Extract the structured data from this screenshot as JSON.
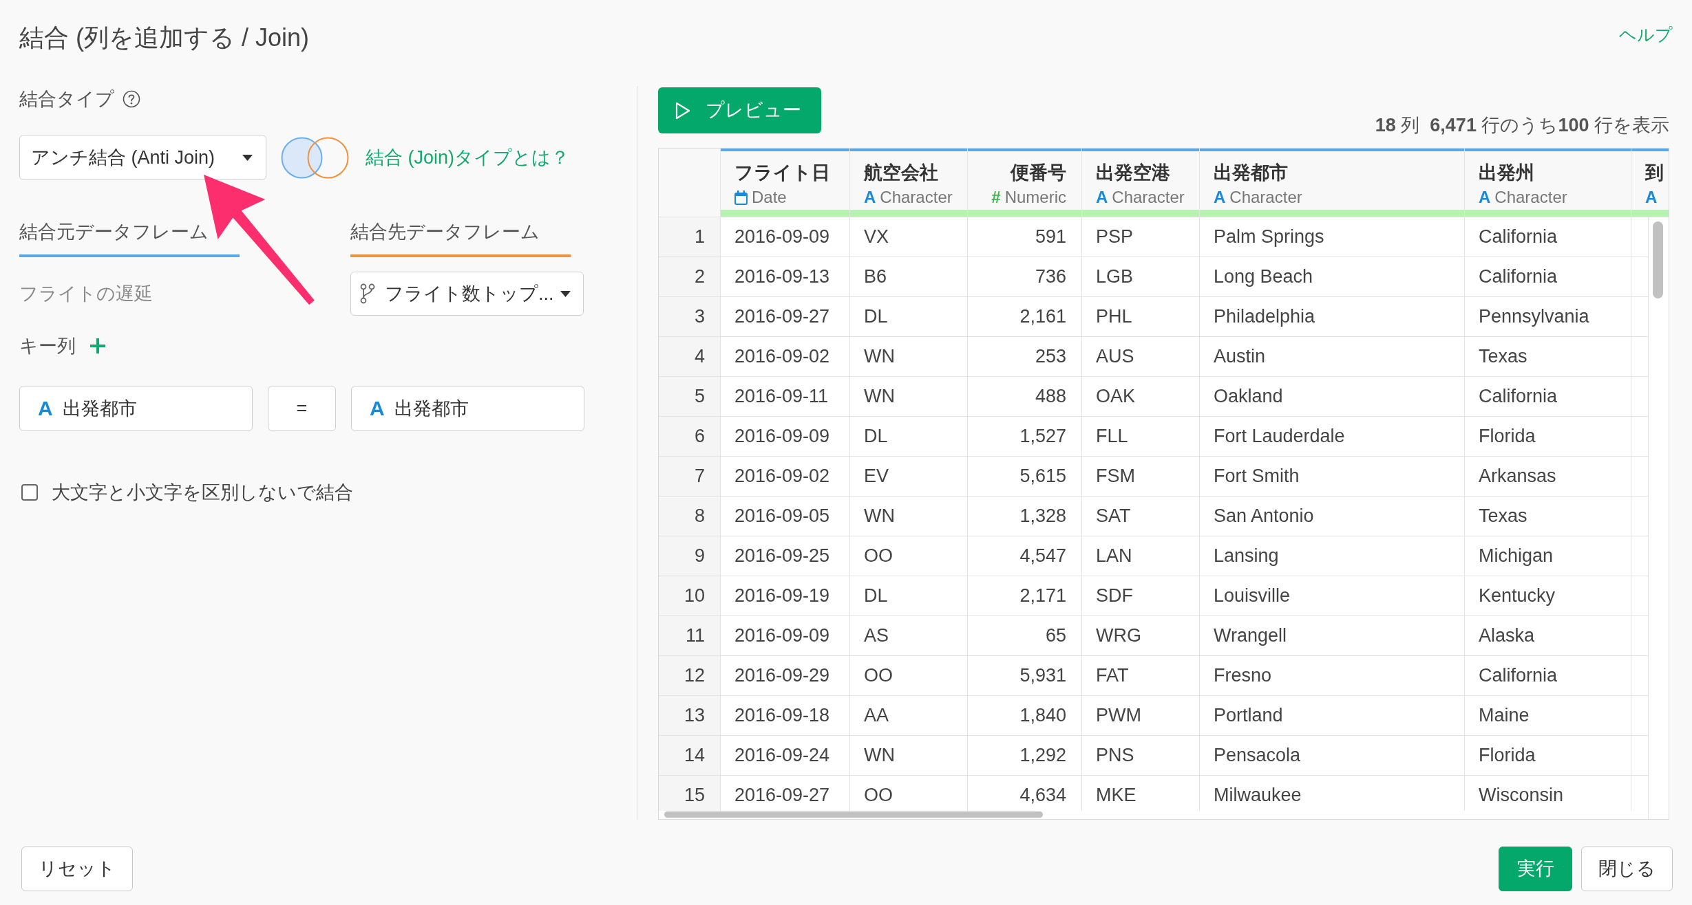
{
  "dialog": {
    "title": "結合 (列を追加する / Join)",
    "help_link": "ヘルプ"
  },
  "join_type": {
    "label": "結合タイプ",
    "value": "アンチ結合 (Anti Join)",
    "link": "結合 (Join)タイプとは？"
  },
  "dataframes": [
    {
      "label": "結合元データフレーム",
      "color": "#5aa9e6",
      "kind": "text",
      "value": "フライトの遅延"
    },
    {
      "label": "結合先データフレーム",
      "color": "#f0923a",
      "kind": "dropdown",
      "value": "フライト数トップ..."
    }
  ],
  "key_columns": {
    "label": "キー列",
    "pairs": [
      {
        "left": {
          "icon": "A",
          "name": "出発都市"
        },
        "operator": "=",
        "right": {
          "icon": "A",
          "name": "出発都市"
        }
      }
    ]
  },
  "case_insensitive": {
    "label": "大文字と小文字を区別しないで結合",
    "checked": false
  },
  "preview": {
    "button": "プレビュー",
    "summary": "**18** 列  **6,471** 行のうち**100** 行を表示"
  },
  "table": {
    "columns": [
      {
        "name": "フライト日",
        "kind": "date",
        "type_label": "Date"
      },
      {
        "name": "航空会社",
        "kind": "character",
        "icon": "A",
        "type_label": "Character"
      },
      {
        "name": "便番号",
        "kind": "numeric",
        "icon": "#",
        "type_label": "Numeric"
      },
      {
        "name": "出発空港",
        "kind": "character",
        "icon": "A",
        "type_label": "Character"
      },
      {
        "name": "出発都市",
        "kind": "character",
        "icon": "A",
        "type_label": "Character"
      },
      {
        "name": "出発州",
        "kind": "character",
        "icon": "A",
        "type_label": "Character"
      },
      {
        "name": "到",
        "kind": "character",
        "icon": "A"
      }
    ],
    "rows": [
      {
        "index": "1",
        "cells": [
          "2016-09-09",
          "VX",
          "591",
          "PSP",
          "Palm Springs",
          "California"
        ]
      },
      {
        "index": "2",
        "cells": [
          "2016-09-13",
          "B6",
          "736",
          "LGB",
          "Long Beach",
          "California"
        ]
      },
      {
        "index": "3",
        "cells": [
          "2016-09-27",
          "DL",
          "2,161",
          "PHL",
          "Philadelphia",
          "Pennsylvania"
        ]
      },
      {
        "index": "4",
        "cells": [
          "2016-09-02",
          "WN",
          "253",
          "AUS",
          "Austin",
          "Texas"
        ]
      },
      {
        "index": "5",
        "cells": [
          "2016-09-11",
          "WN",
          "488",
          "OAK",
          "Oakland",
          "California"
        ]
      },
      {
        "index": "6",
        "cells": [
          "2016-09-09",
          "DL",
          "1,527",
          "FLL",
          "Fort Lauderdale",
          "Florida"
        ]
      },
      {
        "index": "7",
        "cells": [
          "2016-09-02",
          "EV",
          "5,615",
          "FSM",
          "Fort Smith",
          "Arkansas"
        ]
      },
      {
        "index": "8",
        "cells": [
          "2016-09-05",
          "WN",
          "1,328",
          "SAT",
          "San Antonio",
          "Texas"
        ]
      },
      {
        "index": "9",
        "cells": [
          "2016-09-25",
          "OO",
          "4,547",
          "LAN",
          "Lansing",
          "Michigan"
        ]
      },
      {
        "index": "10",
        "cells": [
          "2016-09-19",
          "DL",
          "2,171",
          "SDF",
          "Louisville",
          "Kentucky"
        ]
      },
      {
        "index": "11",
        "cells": [
          "2016-09-09",
          "AS",
          "65",
          "WRG",
          "Wrangell",
          "Alaska"
        ]
      },
      {
        "index": "12",
        "cells": [
          "2016-09-29",
          "OO",
          "5,931",
          "FAT",
          "Fresno",
          "California"
        ]
      },
      {
        "index": "13",
        "cells": [
          "2016-09-18",
          "AA",
          "1,840",
          "PWM",
          "Portland",
          "Maine"
        ]
      },
      {
        "index": "14",
        "cells": [
          "2016-09-24",
          "WN",
          "1,292",
          "PNS",
          "Pensacola",
          "Florida"
        ]
      },
      {
        "index": "15",
        "cells": [
          "2016-09-27",
          "OO",
          "4,634",
          "MKE",
          "Milwaukee",
          "Wisconsin"
        ]
      }
    ]
  },
  "footer": {
    "left_buttons": [
      {
        "label": "リセット",
        "kind": "default"
      }
    ],
    "right_buttons": [
      {
        "label": "実行",
        "kind": "primary"
      },
      {
        "label": "閉じる",
        "kind": "default"
      }
    ]
  }
}
